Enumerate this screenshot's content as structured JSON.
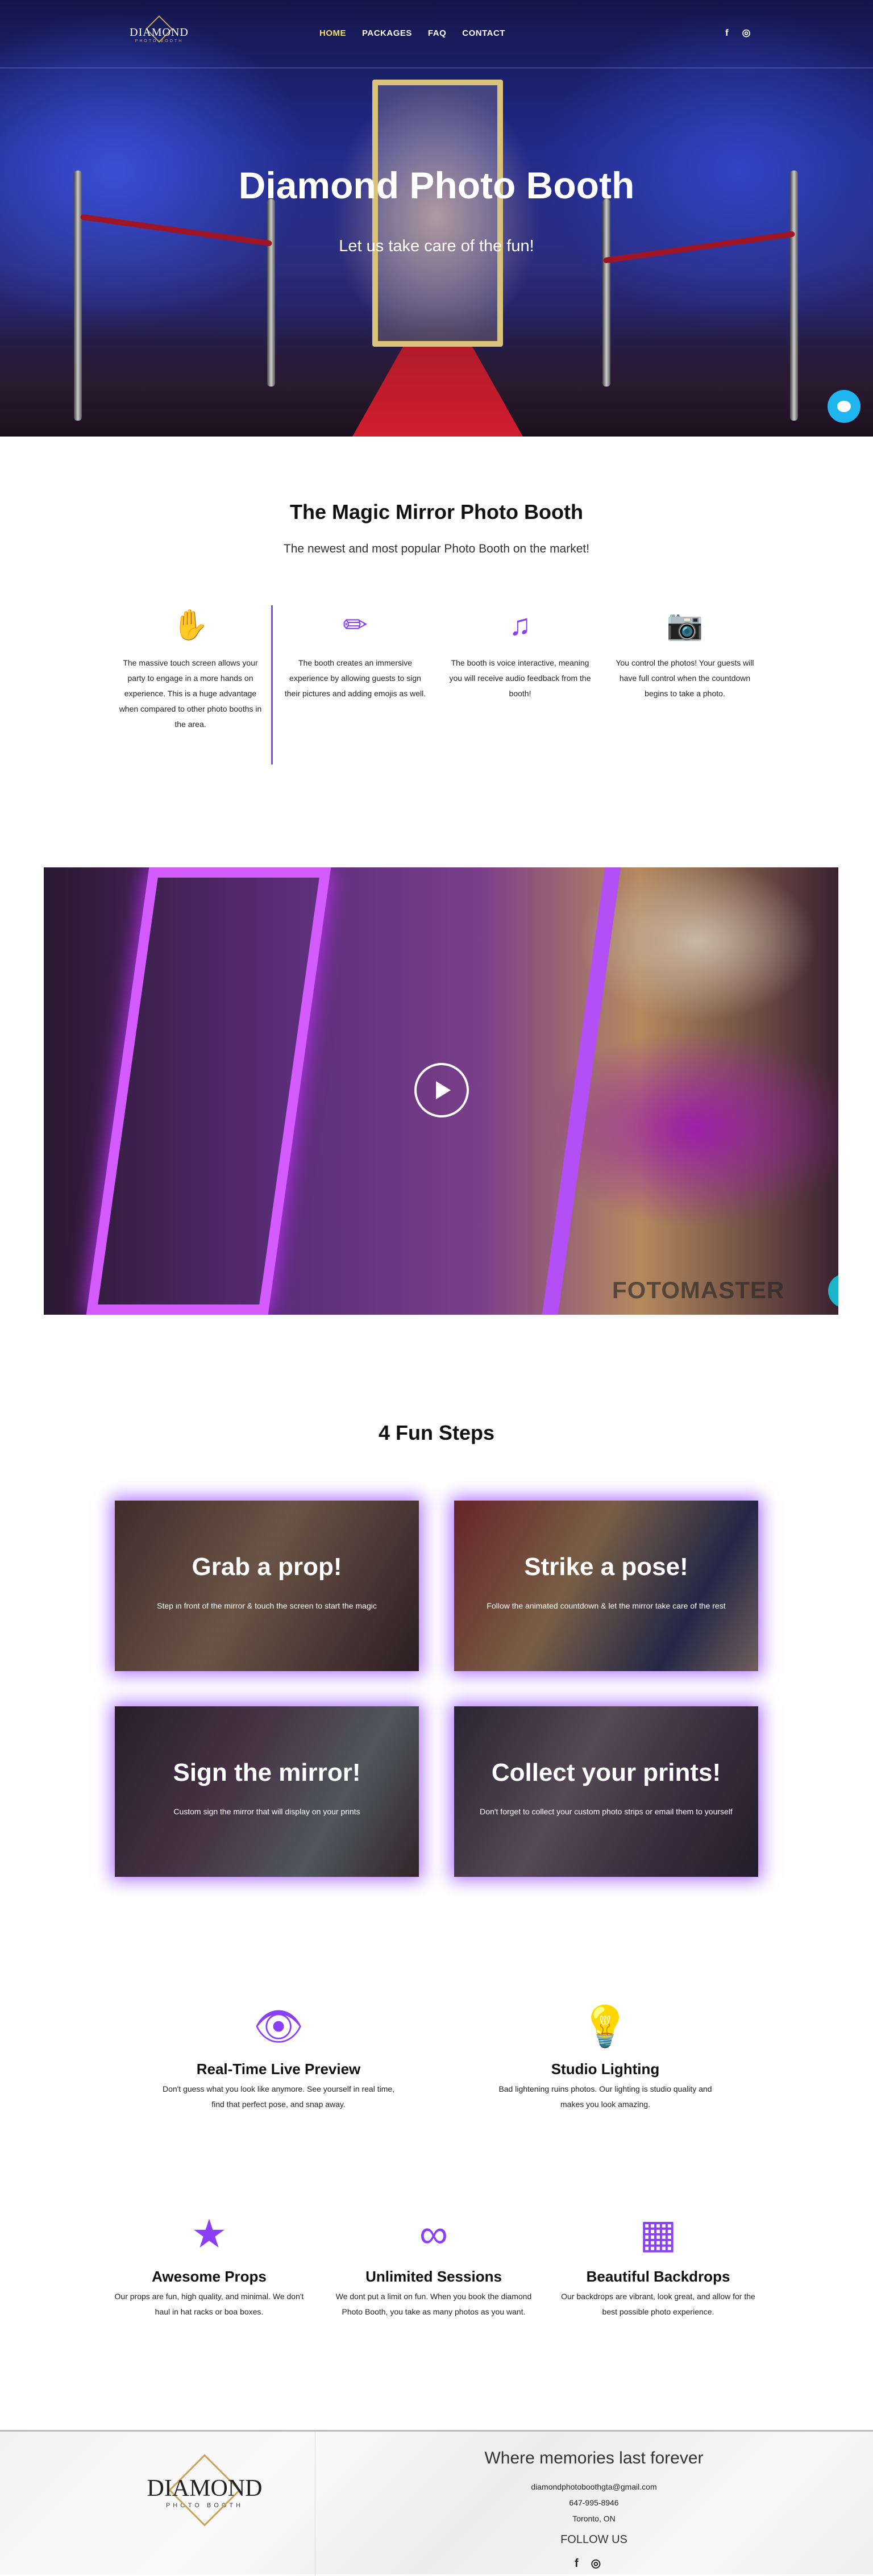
{
  "brand": {
    "logo_name": "DIAMOND",
    "logo_sub": "PHOTO BOOTH"
  },
  "nav": {
    "items": [
      "HOME",
      "PACKAGES",
      "FAQ",
      "CONTACT"
    ],
    "active": "HOME"
  },
  "social": {
    "icons": [
      "facebook-icon",
      "instagram-icon"
    ],
    "glyphs": [
      "f",
      "◎"
    ]
  },
  "hero": {
    "title": "Diamond Photo Booth",
    "subtitle": "Let us take care of the fun!"
  },
  "magic": {
    "title": "The Magic Mirror Photo Booth",
    "subtitle": "The newest and most popular Photo Booth on the market!",
    "features": [
      {
        "icon": "hand-icon",
        "glyph": "✋",
        "text": "The massive touch screen allows your party to engage in a more hands on experience. This is a huge advantage when compared to other photo booths in the area."
      },
      {
        "icon": "pencil-icon",
        "glyph": "✏",
        "text": "The booth creates an immersive experience by allowing guests to sign their pictures and adding emojis as well."
      },
      {
        "icon": "music-note-icon",
        "glyph": "♫",
        "text": "The booth is voice interactive, meaning you will receive audio feedback from the booth!"
      },
      {
        "icon": "camera-icon",
        "glyph": "📷",
        "text": "You control the photos! Your guests will have full control when the countdown begins to take a photo."
      }
    ]
  },
  "video": {
    "watermark": "FOTOMASTER"
  },
  "steps": {
    "title": "4 Fun Steps",
    "items": [
      {
        "title": "Grab a prop!",
        "text": "Step in front of the mirror & touch the screen to start the magic"
      },
      {
        "title": "Strike a pose!",
        "text": "Follow the animated countdown & let the mirror take care of the rest"
      },
      {
        "title": "Sign the mirror!",
        "text": "Custom sign the mirror that will display on your prints"
      },
      {
        "title": "Collect your prints!",
        "text": "Don't forget to collect your custom photo strips or email them to yourself"
      }
    ]
  },
  "perks": [
    {
      "icon": "eye-icon",
      "glyph": "👁",
      "title": "Real-Time Live Preview",
      "text": "Don't guess what you look like anymore. See yourself in real time, find that perfect pose, and snap away."
    },
    {
      "icon": "lightbulb-icon",
      "glyph": "💡",
      "title": "Studio Lighting",
      "text": "Bad lightening ruins photos. Our lighting is studio quality and makes you look amazing."
    },
    {
      "icon": "star-icon",
      "glyph": "★",
      "title": "Awesome Props",
      "text": "Our props are fun, high quality, and minimal. We don't haul in hat racks or boa boxes."
    },
    {
      "icon": "infinity-icon",
      "glyph": "∞",
      "title": "Unlimited Sessions",
      "text": "We dont put a limit on fun. When you book the diamond Photo Booth, you take as many photos as you want."
    },
    {
      "icon": "checker-icon",
      "glyph": "▦",
      "title": "Beautiful Backdrops",
      "text": "Our backdrops are vibrant, look great, and allow for the best possible photo experience."
    }
  ],
  "footer": {
    "tagline": "Where memories last forever",
    "email": "diamondphotoboothgta@gmail.com",
    "phone": "647-995-8946",
    "location": "Toronto, ON",
    "follow": "FOLLOW US"
  },
  "colors": {
    "accent": "#8a3ffc",
    "nav_active": "#f5e15d",
    "chat": "#1fb6f0"
  }
}
